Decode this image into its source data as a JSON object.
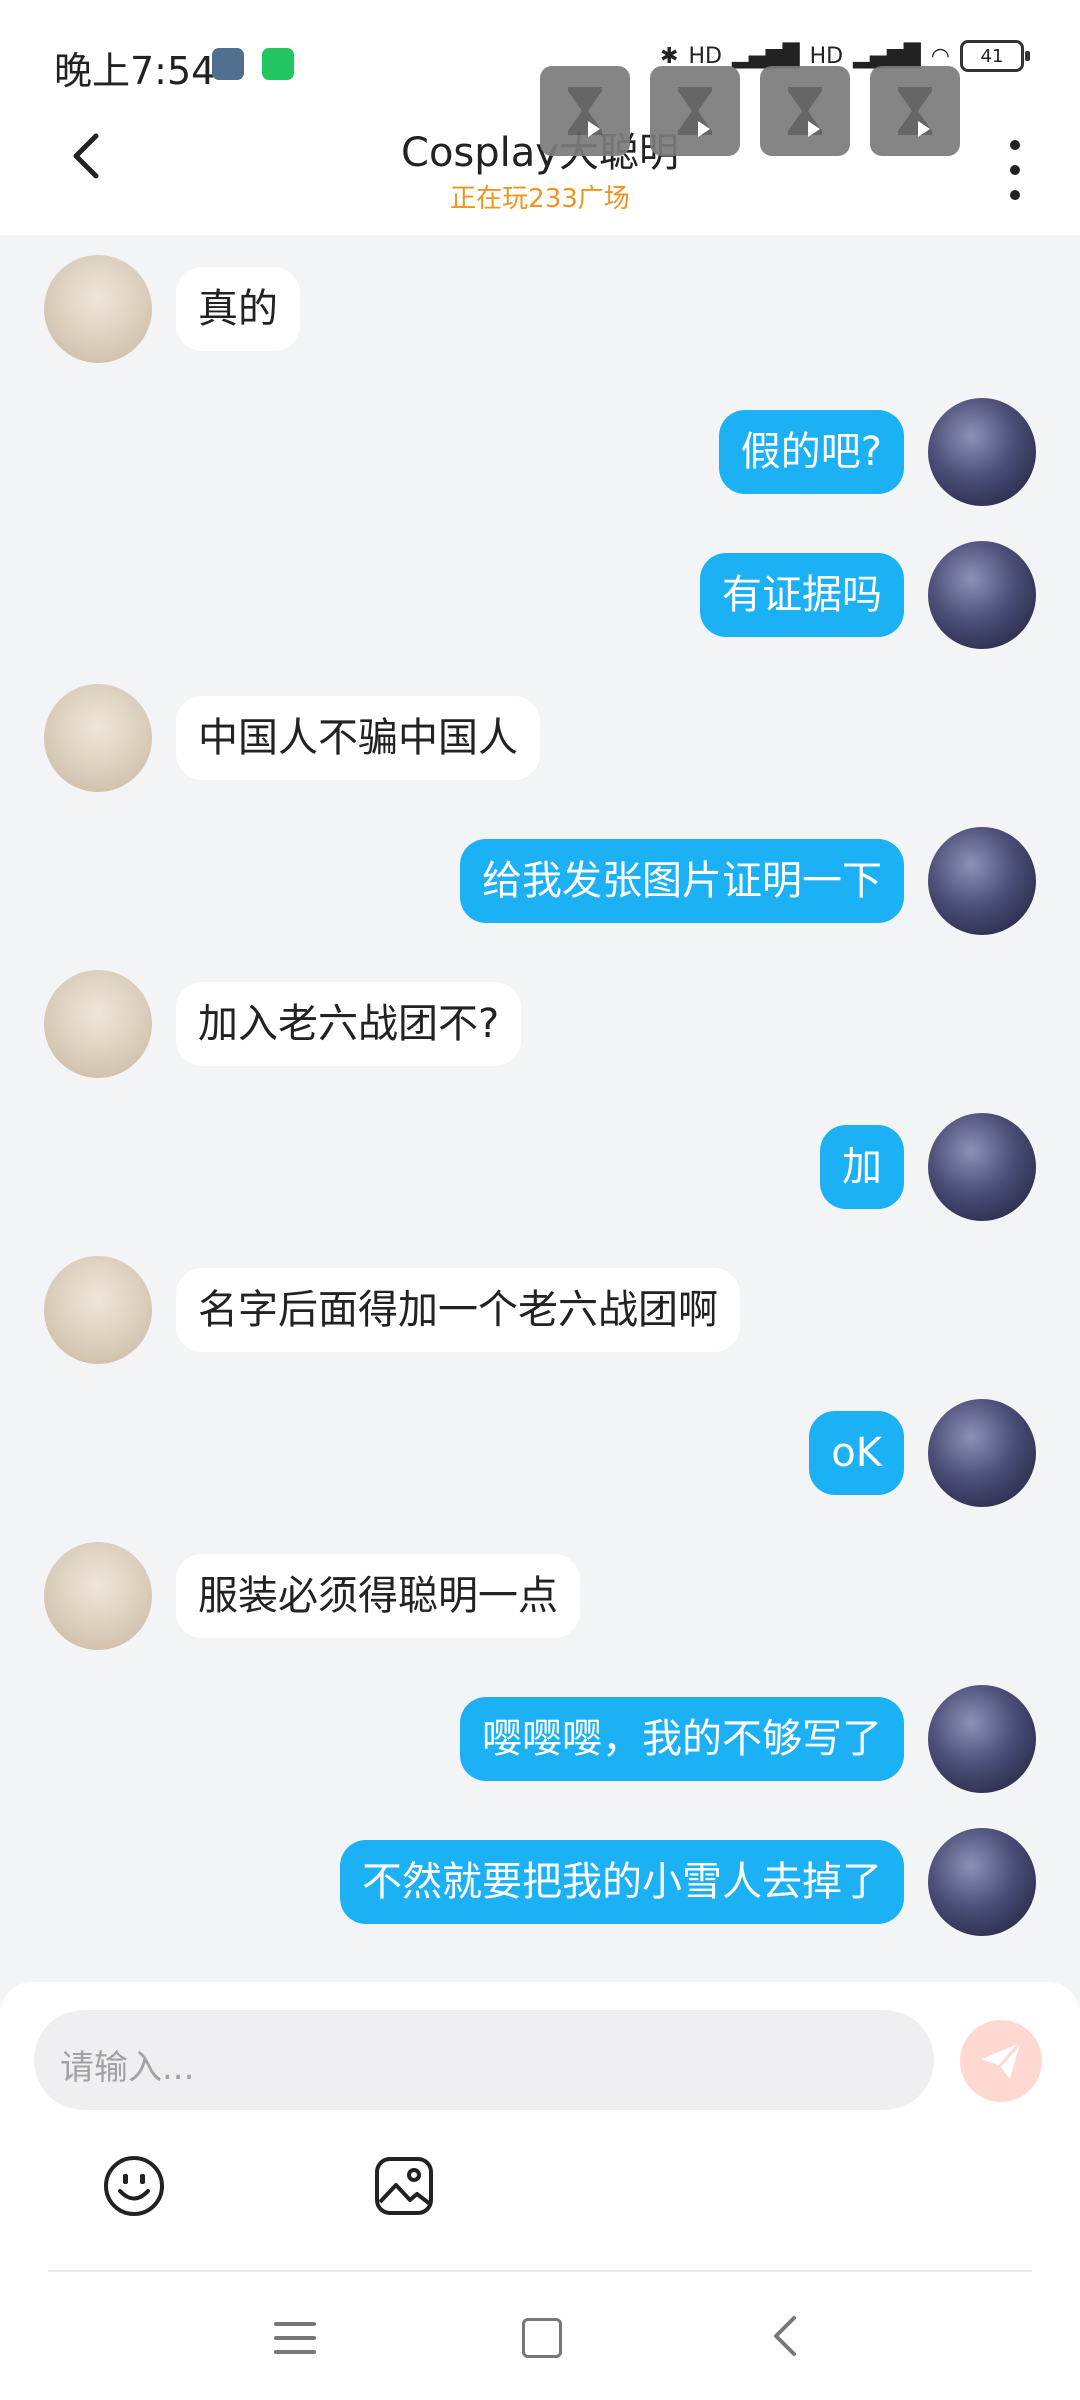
{
  "status_bar": {
    "time": "晚上7:54",
    "battery": "41",
    "net_label_1": "HD",
    "net_label_2": "HD"
  },
  "header": {
    "title": "Cosplay大聪明",
    "subtitle": "正在玩233广场"
  },
  "messages": [
    {
      "side": "left",
      "text": "真的"
    },
    {
      "side": "right",
      "text": "假的吧?"
    },
    {
      "side": "right",
      "text": "有证据吗"
    },
    {
      "side": "left",
      "text": "中国人不骗中国人"
    },
    {
      "side": "right",
      "text": "给我发张图片证明一下"
    },
    {
      "side": "left",
      "text": "加入老六战团不?"
    },
    {
      "side": "right",
      "text": "加"
    },
    {
      "side": "left",
      "text": "名字后面得加一个老六战团啊"
    },
    {
      "side": "right",
      "text": "oK"
    },
    {
      "side": "left",
      "text": "服装必须得聪明一点"
    },
    {
      "side": "right",
      "text": "嘤嘤嘤，我的不够写了"
    },
    {
      "side": "right",
      "text": "不然就要把我的小雪人去掉了"
    }
  ],
  "input": {
    "placeholder": "请输入..."
  },
  "colors": {
    "sent_bubble": "#1cb1f5",
    "received_bubble": "#ffffff",
    "chat_background": "#f3f4f6",
    "subtitle": "#f2931f",
    "send_button": "#ffd8d2"
  }
}
